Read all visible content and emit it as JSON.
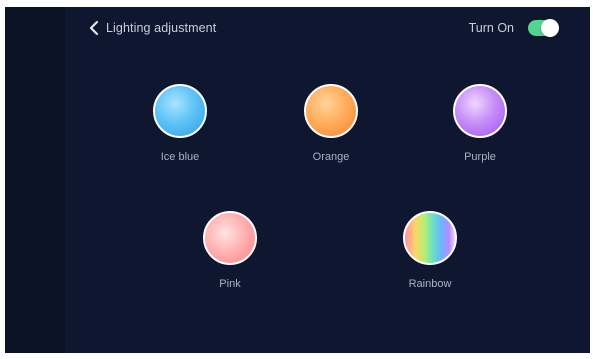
{
  "header": {
    "back_label": "Lighting adjustment",
    "turn_on_label": "Turn On",
    "toggle_on": true
  },
  "colors": {
    "background": "#0f1730",
    "side_strip": "#0b1226",
    "toggle_accent": "#56d48f",
    "label_text": "#aab1c4"
  },
  "swatches": [
    {
      "label": "Ice blue",
      "color": "#5ec3f6"
    },
    {
      "label": "Orange",
      "color": "#ffae5c"
    },
    {
      "label": "Purple",
      "color": "#c78df7"
    },
    {
      "label": "Pink",
      "color": "#ffb3b3"
    },
    {
      "label": "Rainbow",
      "color": "rainbow-gradient"
    }
  ]
}
